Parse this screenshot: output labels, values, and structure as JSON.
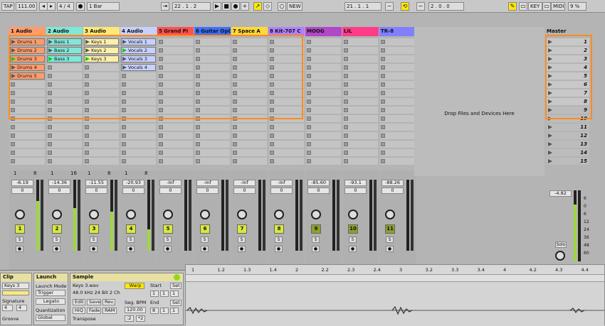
{
  "transport": {
    "tap": "TAP",
    "tempo": "111.00",
    "sig": "4 / 4",
    "quant": "1 Bar",
    "pos": "22 . 1 . 2",
    "new": "NEW",
    "loop_pos": "21 . 1 . 1",
    "loop_len": "2 . 0 . 0",
    "key": "KEY",
    "midi": "MIDI",
    "cpu": "9 %",
    "play": "▶",
    "stop": "■",
    "rec": "●",
    "add": "+"
  },
  "tracks": [
    {
      "name": "1 Audio",
      "color": "#ff9c6c",
      "clips": [
        {
          "row": 1,
          "label": "Drums 1",
          "state": "stopped"
        },
        {
          "row": 2,
          "label": "Drums 2",
          "state": "stopped"
        },
        {
          "row": 3,
          "label": "Drums 3",
          "state": "playing"
        },
        {
          "row": 4,
          "label": "Drums 4",
          "state": "stopped"
        },
        {
          "row": 5,
          "label": "Drums 5",
          "state": "stopped"
        }
      ],
      "clipcolor": "#ff9c6c",
      "send": "1",
      "arm": "8",
      "vol": "-6.19",
      "pan": "0",
      "num": "1",
      "numcolor": "#d8e83c",
      "meter": 0.7
    },
    {
      "name": "2 Audio",
      "color": "#7fe8d8",
      "clips": [
        {
          "row": 1,
          "label": "Bass 1",
          "state": "stopped"
        },
        {
          "row": 2,
          "label": "Bass 2",
          "state": "stopped"
        },
        {
          "row": 3,
          "label": "Bass 3",
          "state": "playing"
        }
      ],
      "clipcolor": "#7fe8d8",
      "send": "1",
      "arm": "16",
      "vol": "-14.36",
      "pan": "0",
      "num": "2",
      "numcolor": "#d8e83c",
      "meter": 0.6
    },
    {
      "name": "3 Audio",
      "color": "#ffe87a",
      "clips": [
        {
          "row": 1,
          "label": "Keys 1",
          "state": "stopped"
        },
        {
          "row": 2,
          "label": "Keys 2",
          "state": "stopped"
        },
        {
          "row": 3,
          "label": "Keys 3",
          "state": "playing"
        }
      ],
      "clipcolor": "#fff0a8",
      "send": "1",
      "arm": "8",
      "vol": "-11.55",
      "pan": "0",
      "num": "3",
      "numcolor": "#d8e83c",
      "meter": 0.55
    },
    {
      "name": "4 Audio",
      "color": "#c8d0ff",
      "clips": [
        {
          "row": 1,
          "label": "Vocals 1",
          "state": "stopped"
        },
        {
          "row": 2,
          "label": "Vocals 2",
          "state": "playing"
        },
        {
          "row": 3,
          "label": "Vocals 3",
          "state": "stopped"
        },
        {
          "row": 4,
          "label": "Vocals 4",
          "state": "stopped"
        }
      ],
      "clipcolor": "#c8d0ff",
      "send": "1",
      "arm": "8",
      "vol": "-20.93",
      "pan": "0",
      "num": "4",
      "numcolor": "#d8e83c",
      "meter": 0.3
    },
    {
      "name": "5 Grand Pi",
      "color": "#ff5050",
      "clips": [],
      "send": "",
      "arm": "",
      "vol": "-Inf",
      "pan": "0",
      "num": "5",
      "numcolor": "#d8e83c",
      "meter": 0
    },
    {
      "name": "6 Guitar OpO",
      "color": "#3c70ff",
      "clips": [],
      "send": "",
      "arm": "",
      "vol": "-Inf",
      "pan": "0",
      "num": "6",
      "numcolor": "#d8e83c",
      "meter": 0
    },
    {
      "name": "7 Space A",
      "color": "#ffd83c",
      "clips": [],
      "send": "",
      "arm": "",
      "vol": "-Inf",
      "pan": "0",
      "num": "7",
      "numcolor": "#d8e83c",
      "meter": 0
    },
    {
      "name": "8 Kit-707 C",
      "color": "#b080ff",
      "clips": [],
      "send": "",
      "arm": "",
      "vol": "-Inf",
      "pan": "0",
      "num": "8",
      "numcolor": "#d8e83c",
      "meter": 0
    },
    {
      "name": "MOOG",
      "color": "#b048c8",
      "clips": [],
      "send": "",
      "arm": "",
      "vol": "-85.60",
      "pan": "0",
      "num": "9",
      "numcolor": "#8ea028",
      "meter": 0
    },
    {
      "name": "LIL",
      "color": "#ff3c88",
      "clips": [],
      "send": "",
      "arm": "",
      "vol": "-93.1",
      "pan": "0",
      "num": "10",
      "numcolor": "#8ea028",
      "meter": 0
    },
    {
      "name": "TR-8",
      "color": "#8080ff",
      "clips": [],
      "send": "",
      "arm": "",
      "vol": "-88.26",
      "pan": "0",
      "num": "11",
      "numcolor": "#8ea028",
      "meter": 0
    }
  ],
  "drop_text": "Drop Files and Devices Here",
  "master": {
    "name": "Master",
    "color": "#ff48d8",
    "scenes": [
      "1",
      "2",
      "3",
      "4",
      "5",
      "6",
      "7",
      "8",
      "9",
      "10",
      "11",
      "12",
      "13",
      "14",
      "15"
    ],
    "vol": "-4.82",
    "db": [
      "6",
      "0",
      "6",
      "12",
      "24",
      "36",
      "48",
      "60"
    ],
    "label": "Solo"
  },
  "clip_panel": {
    "title": "Clip",
    "name": "Keys 3",
    "signature_label": "Signature",
    "sig_num": "4",
    "sig_den": "4",
    "groove_label": "Groove"
  },
  "launch_panel": {
    "title": "Launch",
    "mode_label": "Launch Mode",
    "mode": "Trigger",
    "legato": "Legato",
    "quant_label": "Quantization",
    "quant": "Global"
  },
  "sample_panel": {
    "title": "Sample",
    "file": "Keys 3.wav",
    "info": "48.0 kHz 24 Bit 2 Ch",
    "warp": "Warp",
    "edit": "Edit",
    "save": "Save",
    "rev": "Rev.",
    "hiq": "HiQ",
    "fade": "Fade",
    "ram": "RAM",
    "seg_label": "Seg. BPM",
    "seg": "120.00",
    "transpose_label": "Transpose",
    "btn_half": ":2",
    "btn_double": "*2",
    "start_label": "Start",
    "end_label": "End",
    "set": "Set",
    "start_vals": [
      "1",
      "1",
      "1"
    ],
    "end_vals": [
      "8",
      "1",
      "1"
    ]
  },
  "timeline": [
    "1",
    "1.2",
    "1.3",
    "1.4",
    "2",
    "2.2",
    "2.3",
    "2.4",
    "3",
    "3.2",
    "3.3",
    "3.4",
    "4",
    "4.2",
    "4.3",
    "4.4"
  ]
}
